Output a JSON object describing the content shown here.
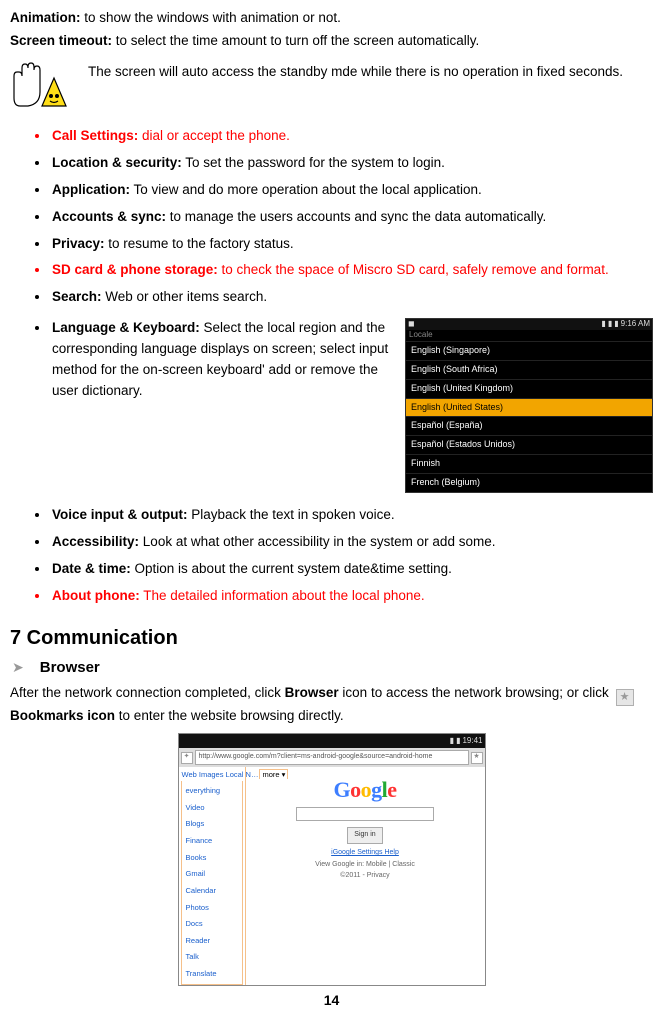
{
  "top": {
    "animation_label": "Animation:",
    "animation_text": " to show the windows with animation or not.",
    "screen_timeout_label": "Screen timeout:",
    "screen_timeout_text": " to select the time amount to turn off the screen automatically.",
    "note_text": "The screen will auto access the standby mde while there is no operation in fixed seconds."
  },
  "items1": [
    {
      "label": "Call Settings:",
      "text": " dial or accept the phone.",
      "red": true
    },
    {
      "label": "Location & security:",
      "text": " To set the password for the system to login.",
      "red": false
    },
    {
      "label": "Application:",
      "text": " To view and do more operation about the local application.",
      "red": false
    },
    {
      "label": "Accounts & sync:",
      "text": " to manage the users accounts and sync the data automatically.",
      "red": false
    },
    {
      "label": "Privacy:",
      "text": " to resume to the factory status.",
      "red": false
    },
    {
      "label": "SD card & phone storage:",
      "text": " to check the space of Miscro SD card, safely remove and format.",
      "red": true
    },
    {
      "label": "Search:",
      "text": " Web or other items search.",
      "red": false
    }
  ],
  "lang_item": {
    "label": "Language & Keyboard:",
    "text": " Select the local region and the corresponding language displays on screen; select input method for the on-screen keyboard' add or remove the user dictionary."
  },
  "locale_shot": {
    "header": "Locale",
    "time": "9:16 AM",
    "items": [
      {
        "t": "English (Singapore)",
        "sel": false
      },
      {
        "t": "English (South Africa)",
        "sel": false
      },
      {
        "t": "English (United Kingdom)",
        "sel": false
      },
      {
        "t": "English (United States)",
        "sel": true
      },
      {
        "t": "Español (España)",
        "sel": false
      },
      {
        "t": "Español (Estados Unidos)",
        "sel": false
      },
      {
        "t": "Finnish",
        "sel": false
      },
      {
        "t": "French (Belgium)",
        "sel": false
      }
    ]
  },
  "items2": [
    {
      "label": "Voice input & output:",
      "text": " Playback the text in spoken voice.",
      "red": false
    },
    {
      "label": "Accessibility:",
      "text": " Look at what other accessibility in the system or add some.",
      "red": false
    },
    {
      "label": "Date & time:",
      "text": " Option is about the current system date&time setting.",
      "red": false
    },
    {
      "label": "About phone:",
      "text": " The detailed information about the local phone.",
      "red": true
    }
  ],
  "section": {
    "title": "7 Communication",
    "sub": "Browser",
    "p_pre": "After the network connection completed, click ",
    "p_b1": "Browser",
    "p_mid": " icon to access the network browsing; or click ",
    "p_b2": " Bookmarks icon",
    "p_post": " to enter the website browsing directly."
  },
  "browser_shot": {
    "time": "19:41",
    "url": "http://www.google.com/m?client=ms-android-google&source=android-home",
    "tabs_pre": "Web  Images  Local  N…",
    "tabs_more": "more ▾",
    "menu": [
      "everything",
      "Video",
      "Blogs",
      "Finance",
      "Books",
      "Gmail",
      "Calendar",
      "Photos",
      "Docs",
      "Reader",
      "Talk",
      "Translate"
    ],
    "search_placeholder": "",
    "sign_btn": "Sign in",
    "links": "iGoogle   Settings   Help",
    "mobile_line": "View Google in: Mobile | Classic",
    "copy_line": "©2011 - Privacy"
  },
  "page_no": "14"
}
